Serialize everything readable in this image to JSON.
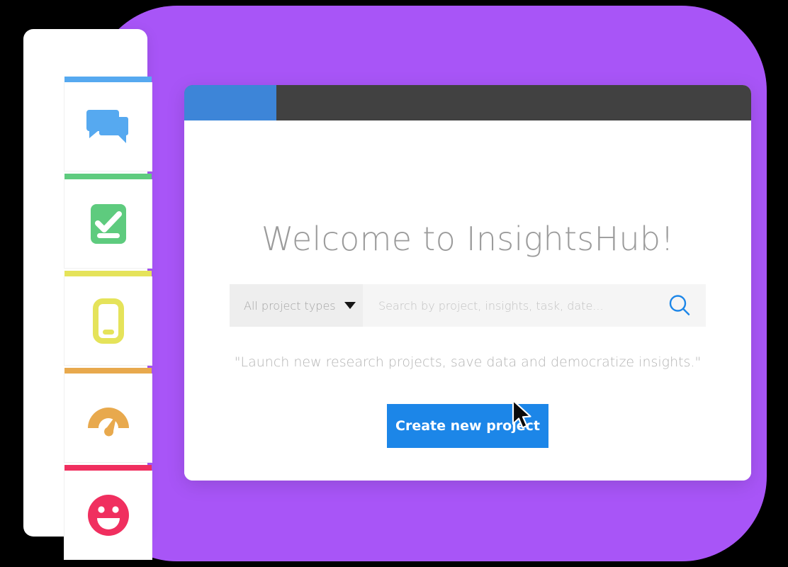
{
  "colors": {
    "backdrop": "#000000",
    "purple_panel": "#a855f7",
    "titlebar": "#414141",
    "browser_tab": "#3d85d8",
    "primary_button": "#1c86e8",
    "search_icon": "#1c86e8",
    "heading_text": "#9b9b9b",
    "tagline_text": "#b4b4b4"
  },
  "sidebar": {
    "items": [
      {
        "name": "discussions",
        "icon": "chat-bubbles-icon",
        "accent": "#56a9f0"
      },
      {
        "name": "tasks",
        "icon": "checklist-icon",
        "accent": "#5ecb7e"
      },
      {
        "name": "mobile",
        "icon": "mobile-phone-icon",
        "accent": "#e5e35a"
      },
      {
        "name": "performance",
        "icon": "gauge-icon",
        "accent": "#e8a94d"
      },
      {
        "name": "satisfaction",
        "icon": "smiley-face-icon",
        "accent": "#f02f5f"
      }
    ]
  },
  "browser": {
    "tab": {
      "name": "active-tab",
      "label": ""
    }
  },
  "main": {
    "title": "Welcome to InsightsHub!",
    "tagline": "\"Launch new research projects, save data and democratize insights.\"",
    "search": {
      "project_type_value": "All project types",
      "placeholder": "Search by project, insights, task, date...",
      "value": "",
      "search_icon": "search-icon"
    },
    "primary_action": "Create new project"
  },
  "cursor": {
    "icon": "mouse-pointer-icon"
  }
}
